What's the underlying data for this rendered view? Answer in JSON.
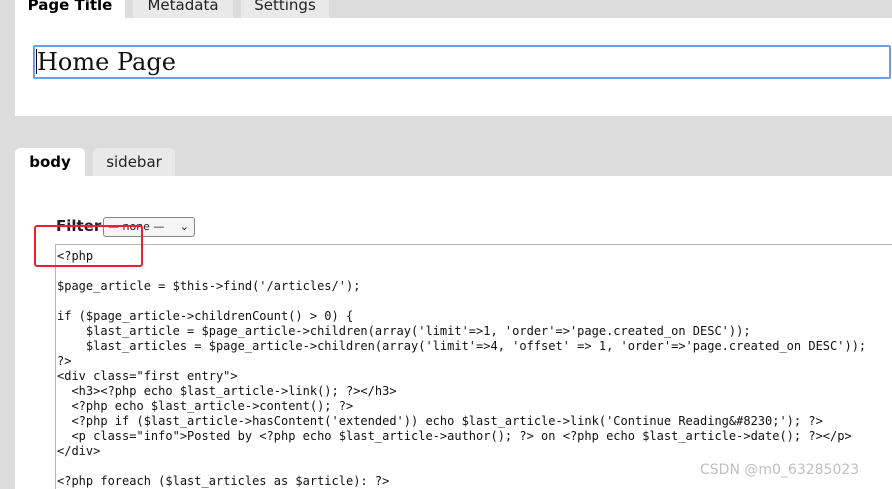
{
  "top_tabs": [
    {
      "label": "Page Title"
    },
    {
      "label": "Metadata"
    },
    {
      "label": "Settings"
    }
  ],
  "title_input": {
    "value": "Home Page"
  },
  "body_tabs": [
    {
      "label": "body"
    },
    {
      "label": "sidebar"
    }
  ],
  "filter": {
    "label": "Filter",
    "selected": "— none —"
  },
  "code": [
    "<?php",
    "",
    "$page_article = $this->find('/articles/');",
    "",
    "if ($page_article->childrenCount() > 0) {",
    "    $last_article = $page_article->children(array('limit'=>1, 'order'=>'page.created_on DESC'));",
    "    $last_articles = $page_article->children(array('limit'=>4, 'offset' => 1, 'order'=>'page.created_on DESC'));",
    "?>",
    "<div class=\"first entry\">",
    "  <h3><?php echo $last_article->link(); ?></h3>",
    "  <?php echo $last_article->content(); ?>",
    "  <?php if ($last_article->hasContent('extended')) echo $last_article->link('Continue Reading&#8230;'); ?>",
    "  <p class=\"info\">Posted by <?php echo $last_article->author(); ?> on <?php echo $last_article->date(); ?></p>",
    "</div>",
    "",
    "<?php foreach ($last_articles as $article): ?>"
  ],
  "watermark": "CSDN @m0_63285023",
  "colors": {
    "highlight": "#e0262a",
    "focus_border": "#6d9de6"
  }
}
